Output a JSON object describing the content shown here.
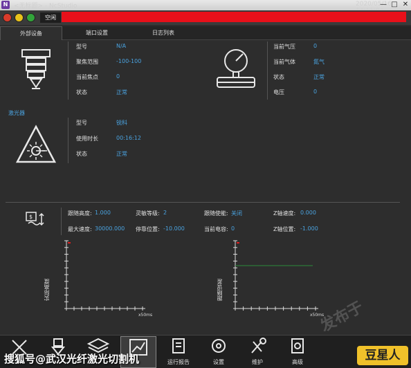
{
  "titlebar": {
    "app_icon": "N",
    "title": "<无标题> - NcStudio",
    "datetime": "2020/05/16 14:11:04",
    "min_glyph": "—",
    "max_glyph": "□",
    "close_glyph": "✕"
  },
  "status": {
    "label": "空闲",
    "led_colors": [
      "#d93b2b",
      "#e8c21b",
      "#32a33a"
    ],
    "bar_color": "#e8101a"
  },
  "tabs": [
    {
      "label": "外部设备",
      "active": true
    },
    {
      "label": "端口设置",
      "active": false
    },
    {
      "label": "日志列表",
      "active": false
    }
  ],
  "head_panel": {
    "icon": "laser-head-icon",
    "rows": [
      {
        "label": "型号",
        "value": "N/A"
      },
      {
        "label": "聚焦范围",
        "value": "-100-100"
      },
      {
        "label": "当前焦点",
        "value": "0"
      },
      {
        "label": "状态",
        "value": "正常"
      }
    ]
  },
  "gas_panel": {
    "icon": "pressure-gauge-icon",
    "rows": [
      {
        "label": "当前气压",
        "value": "0"
      },
      {
        "label": "当前气体",
        "value": "氮气"
      },
      {
        "label": "状态",
        "value": "正常"
      },
      {
        "label": "电压",
        "value": "0"
      }
    ]
  },
  "laser_panel": {
    "title": "激光器",
    "icon": "laser-warning-icon",
    "rows": [
      {
        "label": "型号",
        "value": "锐科"
      },
      {
        "label": "使用时长",
        "value": "00:16:12"
      },
      {
        "label": "状态",
        "value": "正常"
      }
    ]
  },
  "follow_panel": {
    "icon": "follow-height-icon",
    "rows": [
      [
        {
          "label": "跟随高度:",
          "value": "1.000"
        },
        {
          "label": "灵敏等级:",
          "value": "2"
        },
        {
          "label": "跟随使能:",
          "value": "关闭"
        },
        {
          "label": "Z轴速度:",
          "value": "0.000"
        }
      ],
      [
        {
          "label": "最大速度:",
          "value": "30000.000"
        },
        {
          "label": "停靠位置:",
          "value": "-10.000"
        },
        {
          "label": "当前电容:",
          "value": "0"
        },
        {
          "label": "Z轴位置:",
          "value": "-1.000"
        }
      ]
    ]
  },
  "chart_data": [
    {
      "type": "line",
      "ylabel": "实际高度",
      "x_unit": "x50ms",
      "series": []
    },
    {
      "type": "line",
      "ylabel": "跟随误差",
      "x_unit": "x50ms",
      "series": []
    }
  ],
  "toolbar": [
    {
      "label": "",
      "icon": "tools-icon"
    },
    {
      "label": "",
      "icon": "nozzle-icon"
    },
    {
      "label": "",
      "icon": "layers-icon"
    },
    {
      "label": "",
      "icon": "chart-icon",
      "active": true
    },
    {
      "label": "运行报告",
      "icon": "report-icon"
    },
    {
      "label": "设置",
      "icon": "gear-icon"
    },
    {
      "label": "维护",
      "icon": "wrench-icon"
    },
    {
      "label": "高级",
      "icon": "advanced-icon"
    }
  ],
  "watermarks": {
    "bottom": "搜狐号@武汉光纤激光切割机",
    "right": "豆星人",
    "faint": "发布于"
  }
}
